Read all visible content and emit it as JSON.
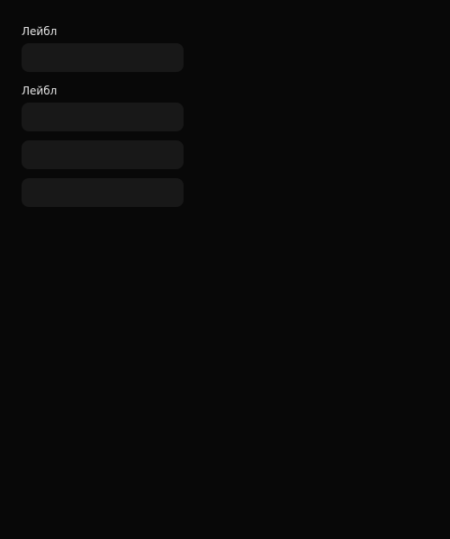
{
  "form": {
    "group1": {
      "label": "Лейбл",
      "fields": [
        {
          "value": "",
          "placeholder": ""
        }
      ]
    },
    "group2": {
      "label": "Лейбл",
      "fields": [
        {
          "value": "",
          "placeholder": ""
        },
        {
          "value": "",
          "placeholder": ""
        },
        {
          "value": "",
          "placeholder": ""
        }
      ]
    }
  }
}
